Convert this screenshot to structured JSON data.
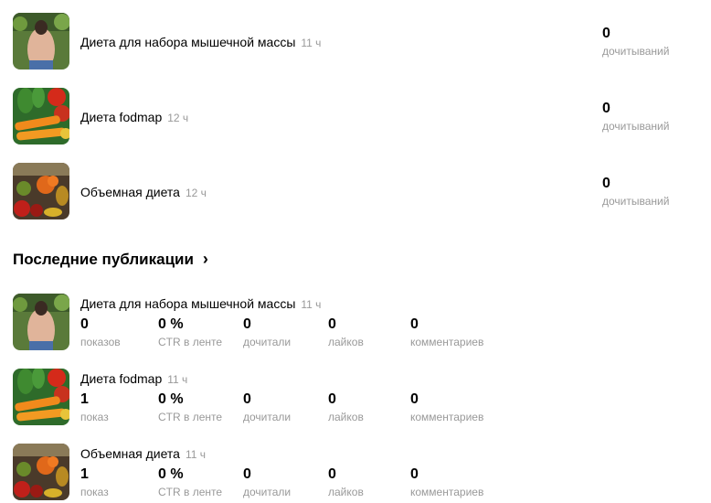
{
  "top_articles": [
    {
      "title": "Диета для набора мышечной массы",
      "age": "11 ч",
      "reads_value": "0",
      "reads_label": "дочитываний",
      "thumb": "back-photo"
    },
    {
      "title": "Диета fodmap",
      "age": "12 ч",
      "reads_value": "0",
      "reads_label": "дочитываний",
      "thumb": "vegetables-photo"
    },
    {
      "title": "Объемная диета",
      "age": "12 ч",
      "reads_value": "0",
      "reads_label": "дочитываний",
      "thumb": "produce-photo"
    }
  ],
  "recent": {
    "header": "Последние публикации",
    "chevron_icon": "chevron-right-icon",
    "items": [
      {
        "title": "Диета для набора мышечной массы",
        "age": "11 ч",
        "thumb": "back-photo",
        "stats": [
          {
            "value": "0",
            "label": "показов"
          },
          {
            "value": "0 %",
            "label": "CTR в ленте"
          },
          {
            "value": "0",
            "label": "дочитали"
          },
          {
            "value": "0",
            "label": "лайков"
          },
          {
            "value": "0",
            "label": "комментариев"
          }
        ]
      },
      {
        "title": "Диета fodmap",
        "age": "11 ч",
        "thumb": "vegetables-photo",
        "stats": [
          {
            "value": "1",
            "label": "показ"
          },
          {
            "value": "0 %",
            "label": "CTR в ленте"
          },
          {
            "value": "0",
            "label": "дочитали"
          },
          {
            "value": "0",
            "label": "лайков"
          },
          {
            "value": "0",
            "label": "комментариев"
          }
        ]
      },
      {
        "title": "Объемная диета",
        "age": "11 ч",
        "thumb": "produce-photo",
        "stats": [
          {
            "value": "1",
            "label": "показ"
          },
          {
            "value": "0 %",
            "label": "CTR в ленте"
          },
          {
            "value": "0",
            "label": "дочитали"
          },
          {
            "value": "0",
            "label": "лайков"
          },
          {
            "value": "0",
            "label": "комментариев"
          }
        ]
      }
    ]
  }
}
